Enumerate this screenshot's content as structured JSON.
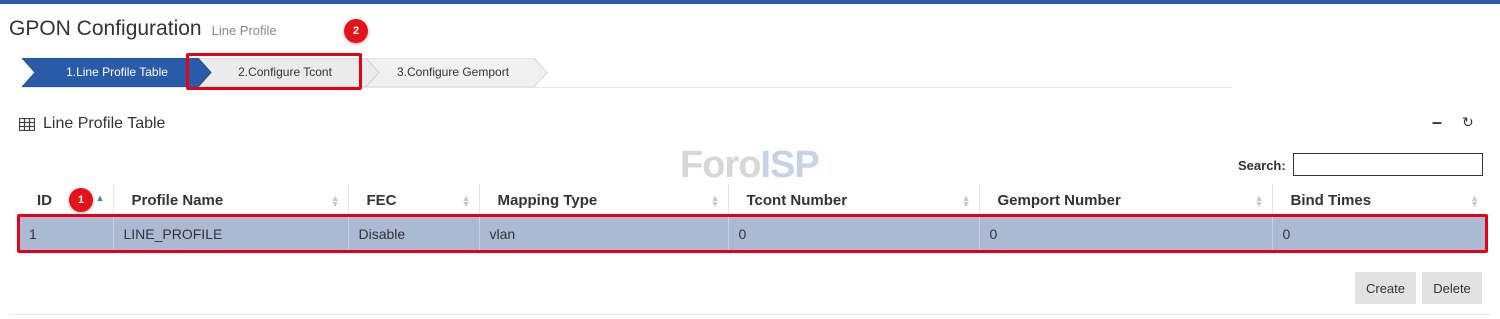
{
  "header": {
    "title": "GPON Configuration",
    "subtitle": "Line Profile"
  },
  "steps": [
    {
      "label": "1.Line Profile Table",
      "active": true
    },
    {
      "label": "2.Configure Tcont",
      "active": false
    },
    {
      "label": "3.Configure Gemport",
      "active": false
    }
  ],
  "callouts": {
    "badge_1": "1",
    "badge_2": "2"
  },
  "panel": {
    "title": "Line Profile Table",
    "icon": "table-icon",
    "collapse_symbol": "–",
    "refresh_symbol": "↻"
  },
  "watermark": {
    "part1": "Foro",
    "part2": "ISP"
  },
  "search": {
    "label": "Search:",
    "value": ""
  },
  "table": {
    "columns": [
      "ID",
      "Profile Name",
      "FEC",
      "Mapping Type",
      "Tcont Number",
      "Gemport Number",
      "Bind Times"
    ],
    "rows": [
      [
        "1",
        "LINE_PROFILE",
        "Disable",
        "vlan",
        "0",
        "0",
        "0"
      ]
    ]
  },
  "actions": {
    "create": "Create",
    "delete": "Delete"
  },
  "colors": {
    "accent": "#2a5ba8",
    "selected_row": "#abb9d3",
    "callout": "#e0001a"
  }
}
